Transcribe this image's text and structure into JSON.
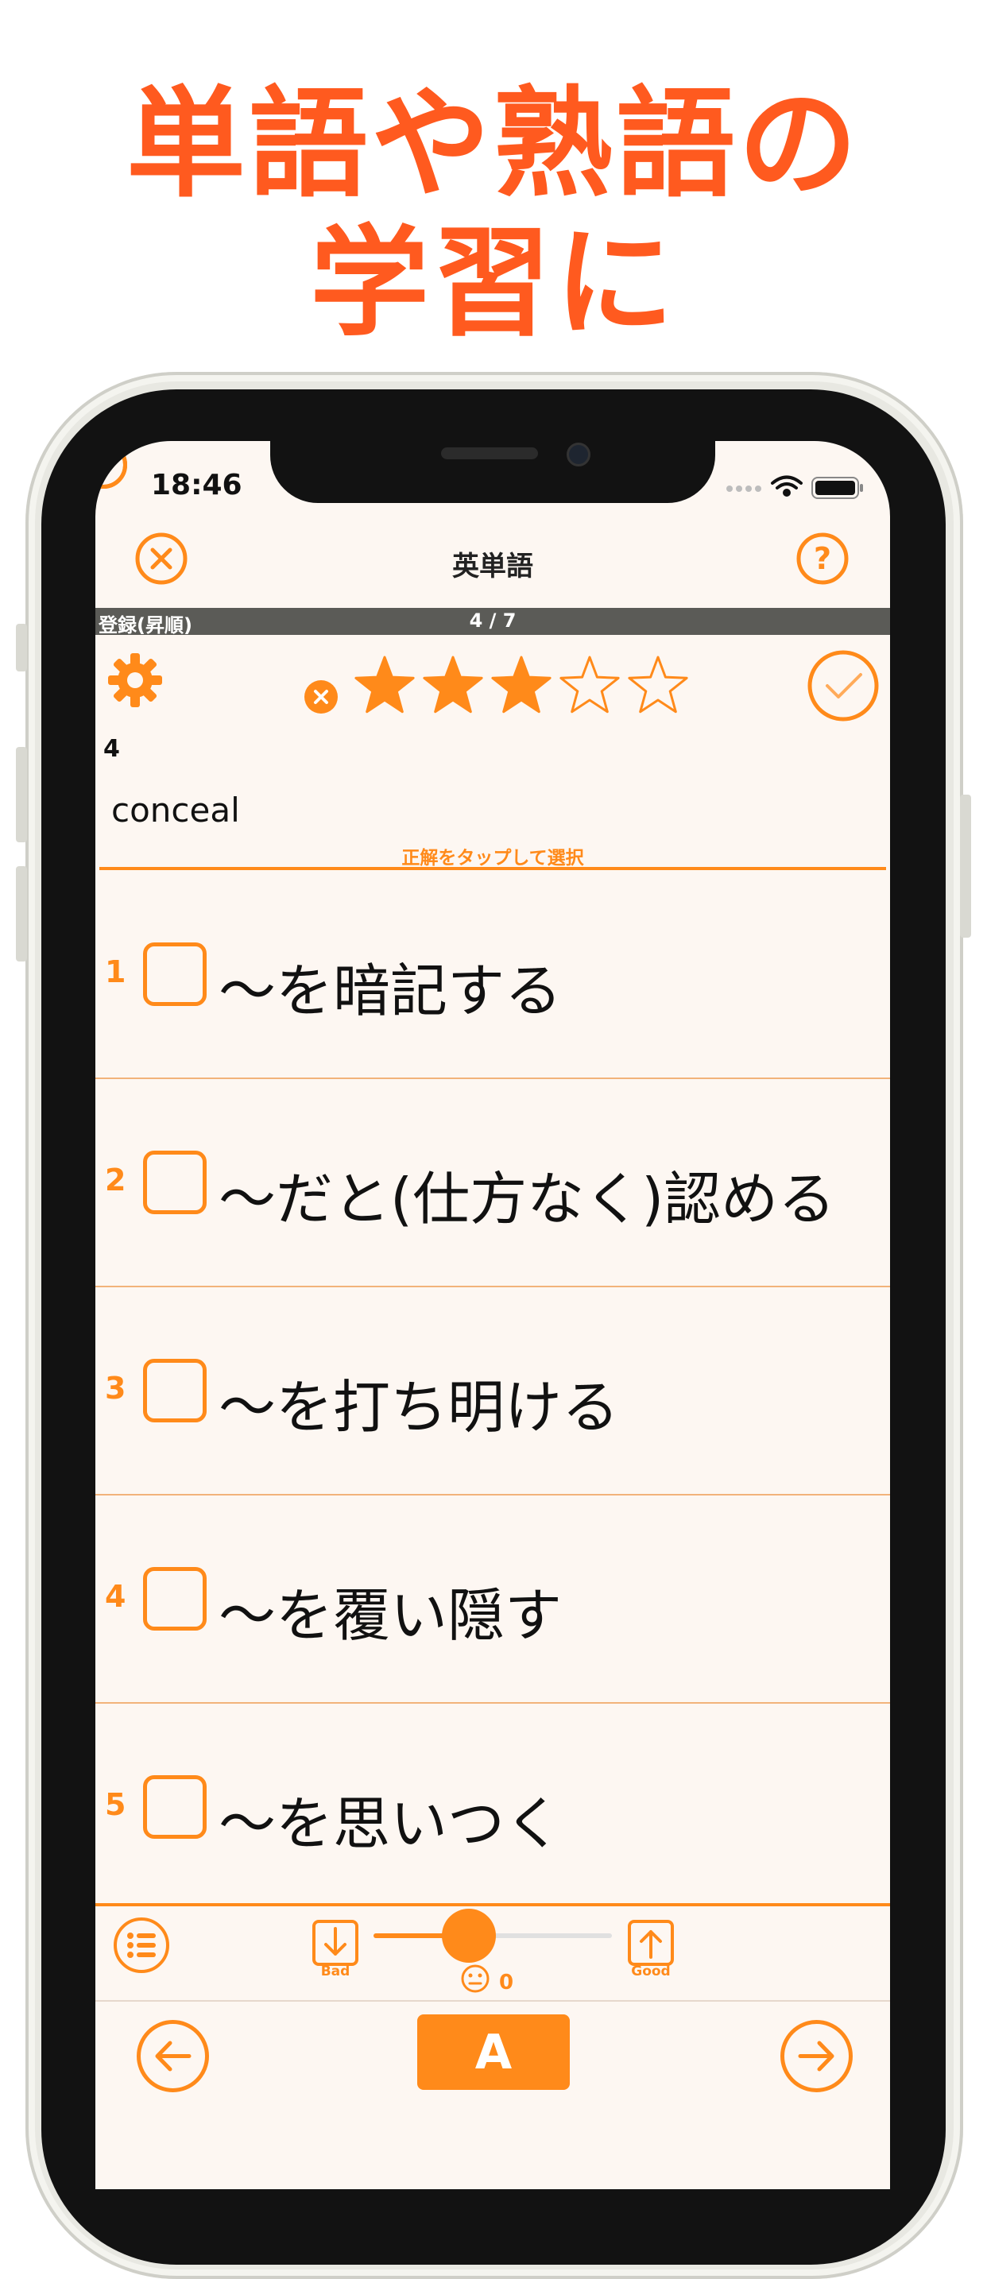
{
  "headline": {
    "line1": "単語や熟語の",
    "line2": "学習に"
  },
  "status_bar": {
    "time": "18:46"
  },
  "nav": {
    "title": "英単語",
    "close_icon": "close-icon",
    "help_icon": "help-icon"
  },
  "info_bar": {
    "mode": "登録(昇順)",
    "progress": "4 / 7"
  },
  "card": {
    "rating": 3,
    "rating_max": 5,
    "number": "4",
    "word": "conceal",
    "hint": "正解をタップして選択"
  },
  "choices": [
    {
      "num": "1",
      "text": "〜を暗記する"
    },
    {
      "num": "2",
      "text": "〜だと(仕方なく)認める"
    },
    {
      "num": "3",
      "text": "〜を打ち明ける"
    },
    {
      "num": "4",
      "text": "〜を覆い隠す"
    },
    {
      "num": "5",
      "text": "〜を思いつく"
    }
  ],
  "toolbar": {
    "bad_label": "Bad",
    "good_label": "Good",
    "mood_value": "0",
    "slider_level": 0.4
  },
  "footer": {
    "center_button": "A"
  },
  "colors": {
    "accent": "#ff8a1a",
    "headline": "#ff5a1f"
  }
}
